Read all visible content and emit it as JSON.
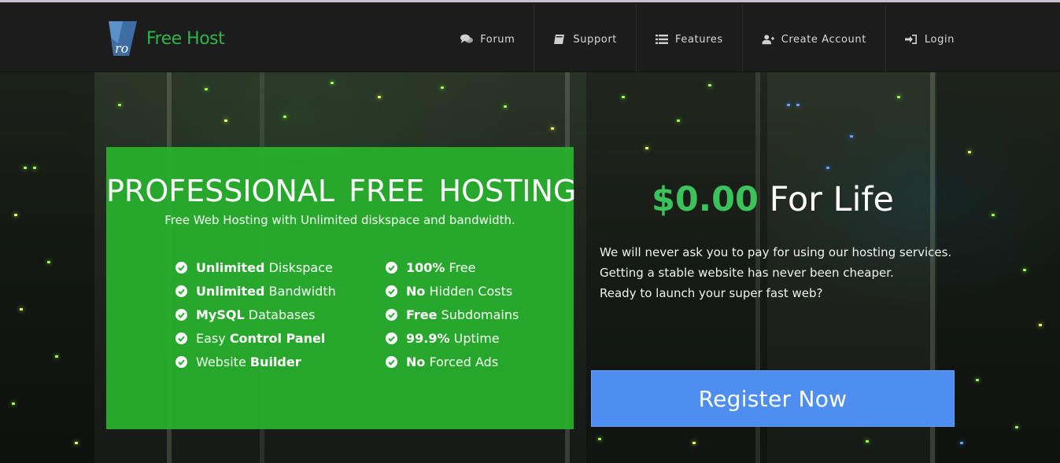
{
  "brand": {
    "logo_icon": "pro-logo-icon",
    "logo_mark_text": "ro",
    "name": "Free Host",
    "color": "#2fb44a"
  },
  "nav": [
    {
      "label": "Forum",
      "icon": "comments-icon"
    },
    {
      "label": "Support",
      "icon": "book-icon"
    },
    {
      "label": "Features",
      "icon": "list-icon"
    },
    {
      "label": "Create Account",
      "icon": "user-plus-icon"
    },
    {
      "label": "Login",
      "icon": "sign-in-icon"
    }
  ],
  "hero": {
    "title": "PROFESSIONAL FREE HOSTING",
    "subtitle": "Free Web Hosting with Unlimited diskspace and bandwidth.",
    "card_color": "#28b22d",
    "features_left": [
      {
        "bold": "Unlimited",
        "rest": " Diskspace"
      },
      {
        "bold": "Unlimited",
        "rest": " Bandwidth"
      },
      {
        "bold": "MySQL",
        "rest": " Databases"
      },
      {
        "pre": "Easy ",
        "bold": "Control Panel"
      },
      {
        "pre": "Website ",
        "bold": "Builder"
      }
    ],
    "features_right": [
      {
        "bold": "100%",
        "rest": " Free"
      },
      {
        "bold": "No",
        "rest": " Hidden Costs"
      },
      {
        "bold": "Free",
        "rest": " Subdomains"
      },
      {
        "bold": "99.9%",
        "rest": " Uptime"
      },
      {
        "bold": "No",
        "rest": " Forced Ads"
      }
    ],
    "check_icon": "check-circle-icon"
  },
  "offer": {
    "price": "$0.00",
    "price_suffix": " For Life",
    "price_color": "#3bc25a",
    "lines": [
      "We will never ask you to pay for using our hosting services.",
      "Getting a stable website has never been cheaper.",
      "Ready to launch your super fast web?"
    ],
    "cta": "Register Now",
    "cta_color": "#4e8ef0"
  }
}
